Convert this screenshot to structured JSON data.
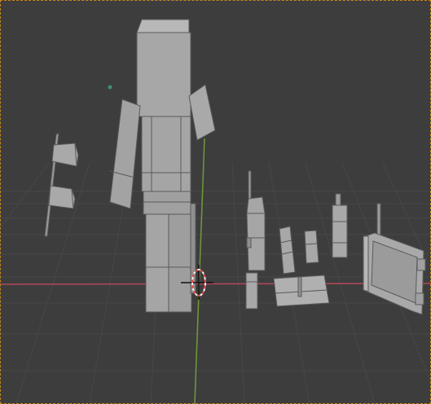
{
  "app": {
    "view": "3d-viewport",
    "shading": "solid",
    "selection_active": true
  },
  "colors": {
    "background": "#3d3d3d",
    "grid": "#474747",
    "x_axis": "#b3485a",
    "y_axis": "#6f9a3c",
    "mesh_light": "#a7a7a7",
    "mesh_shadow": "#8a8a8a",
    "edge": "#5a5a5a",
    "selection_border": "#c8841e",
    "cursor_red": "#e34a4a",
    "cursor_white": "#f2f2f2",
    "empty_dot": "#3f8f77"
  },
  "scene": {
    "objects": [
      "figure",
      "flag",
      "antenna-post",
      "small-block-a",
      "small-block-b",
      "tall-block",
      "slab-with-lever",
      "short-post",
      "framed-panel"
    ],
    "icons": [
      "3d-cursor-icon"
    ]
  }
}
